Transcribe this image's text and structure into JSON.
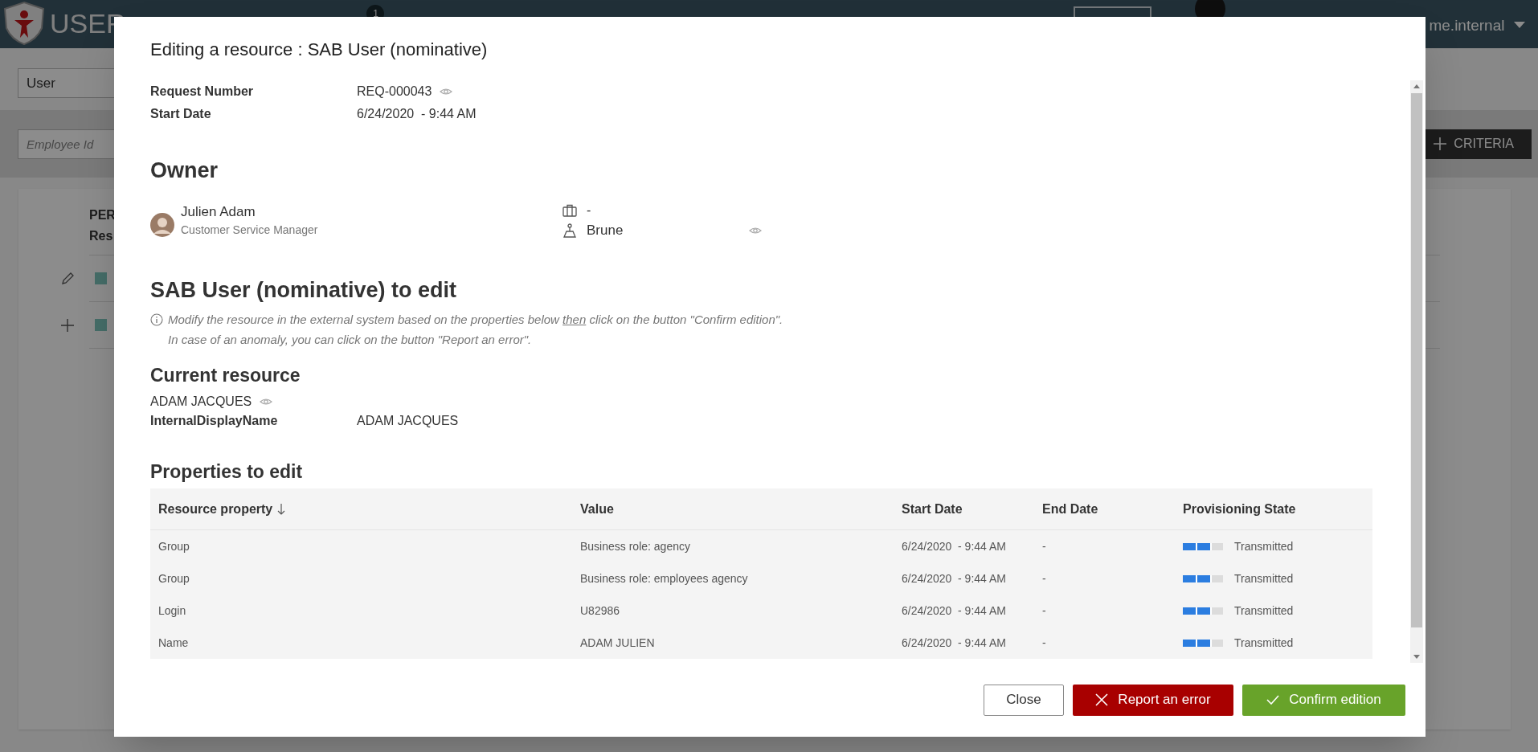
{
  "app_header": {
    "logo_text": "USER",
    "notification_count": "1",
    "user_name": "me.internal"
  },
  "background": {
    "filter_select": "User",
    "search_placeholder": "Employee Id",
    "criteria_button": "CRITERIA",
    "list_header": [
      "PER",
      "Res"
    ],
    "list_rows": [
      {
        "kind": "edit"
      },
      {
        "kind": "add"
      }
    ]
  },
  "dialog": {
    "title": "Editing a resource : SAB User (nominative)",
    "request_fields": [
      {
        "label": "Request Number",
        "value": "REQ-000043",
        "viewable": true
      },
      {
        "label": "Start Date",
        "value": "6/24/2020  - 9:44 AM"
      }
    ],
    "owner": {
      "heading": "Owner",
      "name": "Julien Adam",
      "job_title": "Customer Service Manager",
      "organization": "-",
      "location": "Brune",
      "viewable": true
    },
    "resource_section": {
      "heading": "SAB User (nominative) to edit",
      "instruction_line_1": {
        "before": "Modify the resource in the external system based on the properties below ",
        "underlined": "then",
        "after": " click on the button \"Confirm edition\"."
      },
      "instruction_line_2": "In case of an anomaly, you can click on the button \"Report an error\"."
    },
    "current_resource": {
      "heading": "Current resource",
      "display_name": "ADAM JACQUES",
      "viewable": true,
      "properties": [
        {
          "label": "InternalDisplayName",
          "value": "ADAM JACQUES"
        }
      ]
    },
    "properties_table": {
      "heading": "Properties to edit",
      "columns": [
        {
          "label": "Resource property",
          "sorted": true
        },
        {
          "label": "Value",
          "sorted": false
        },
        {
          "label": "Start Date",
          "sorted": false
        },
        {
          "label": "End Date",
          "sorted": false
        },
        {
          "label": "Provisioning State",
          "sorted": false
        }
      ],
      "rows": [
        {
          "property": "Group",
          "value": "Business role: agency",
          "start_date": "6/24/2020  - 9:44 AM",
          "end_date": "-",
          "state": "Transmitted",
          "level": 0.67
        },
        {
          "property": "Group",
          "value": "Business role: employees agency",
          "start_date": "6/24/2020  - 9:44 AM",
          "end_date": "-",
          "state": "Transmitted",
          "level": 0.67
        },
        {
          "property": "Login",
          "value": "U82986",
          "start_date": "6/24/2020  - 9:44 AM",
          "end_date": "-",
          "state": "Transmitted",
          "level": 0.67
        },
        {
          "property": "Name",
          "value": "ADAM JULIEN",
          "start_date": "6/24/2020  - 9:44 AM",
          "end_date": "-",
          "state": "Transmitted",
          "level": 0.67
        }
      ]
    },
    "buttons": [
      {
        "label": "Close",
        "kind": "secondary"
      },
      {
        "label": "Report an error",
        "kind": "danger"
      },
      {
        "label": "Confirm edition",
        "kind": "primary"
      }
    ]
  }
}
